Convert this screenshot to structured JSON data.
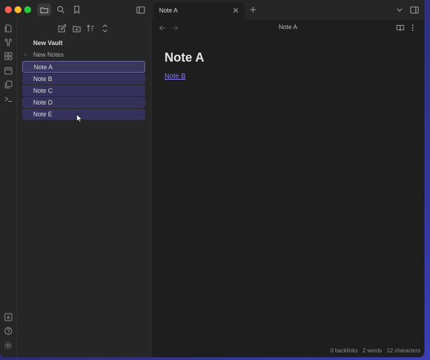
{
  "window": {
    "traffic_lights": {
      "close": "#ff5f57",
      "minimize": "#febc2e",
      "zoom": "#28c840"
    }
  },
  "titlebar": {
    "icons": [
      "folder-icon",
      "search-icon",
      "bookmark-icon",
      "sidebar-toggle-icon"
    ],
    "tab": {
      "title": "Note A"
    },
    "new_tab_icon": "plus-icon",
    "tab_list_icon": "chevron-down-icon",
    "right_sidebar_icon": "right-sidebar-toggle-icon"
  },
  "ribbon": {
    "top_icons": [
      "files-icon",
      "graph-icon",
      "canvas-icon",
      "calendar-icon",
      "templates-icon",
      "terminal-icon"
    ],
    "bottom_icons": [
      "vault-switch-icon",
      "help-icon",
      "settings-icon"
    ]
  },
  "sidebar": {
    "tools": [
      "new-note-icon",
      "new-folder-icon",
      "sort-icon",
      "collapse-icon"
    ],
    "vault_name": "New Vault",
    "folder": {
      "label": "New Notes"
    },
    "files": [
      {
        "label": "Note A",
        "active": true
      },
      {
        "label": "Note B"
      },
      {
        "label": "Note C"
      },
      {
        "label": "Note D"
      },
      {
        "label": "Note E"
      }
    ]
  },
  "main": {
    "view_title": "Note A",
    "heading": "Note A",
    "link_text": "Note B"
  },
  "status": {
    "backlinks": "0 backlinks",
    "words": "2 words",
    "characters": "12 characters"
  },
  "colors": {
    "accent": "#8a7cf6",
    "selection": "#34315a"
  }
}
